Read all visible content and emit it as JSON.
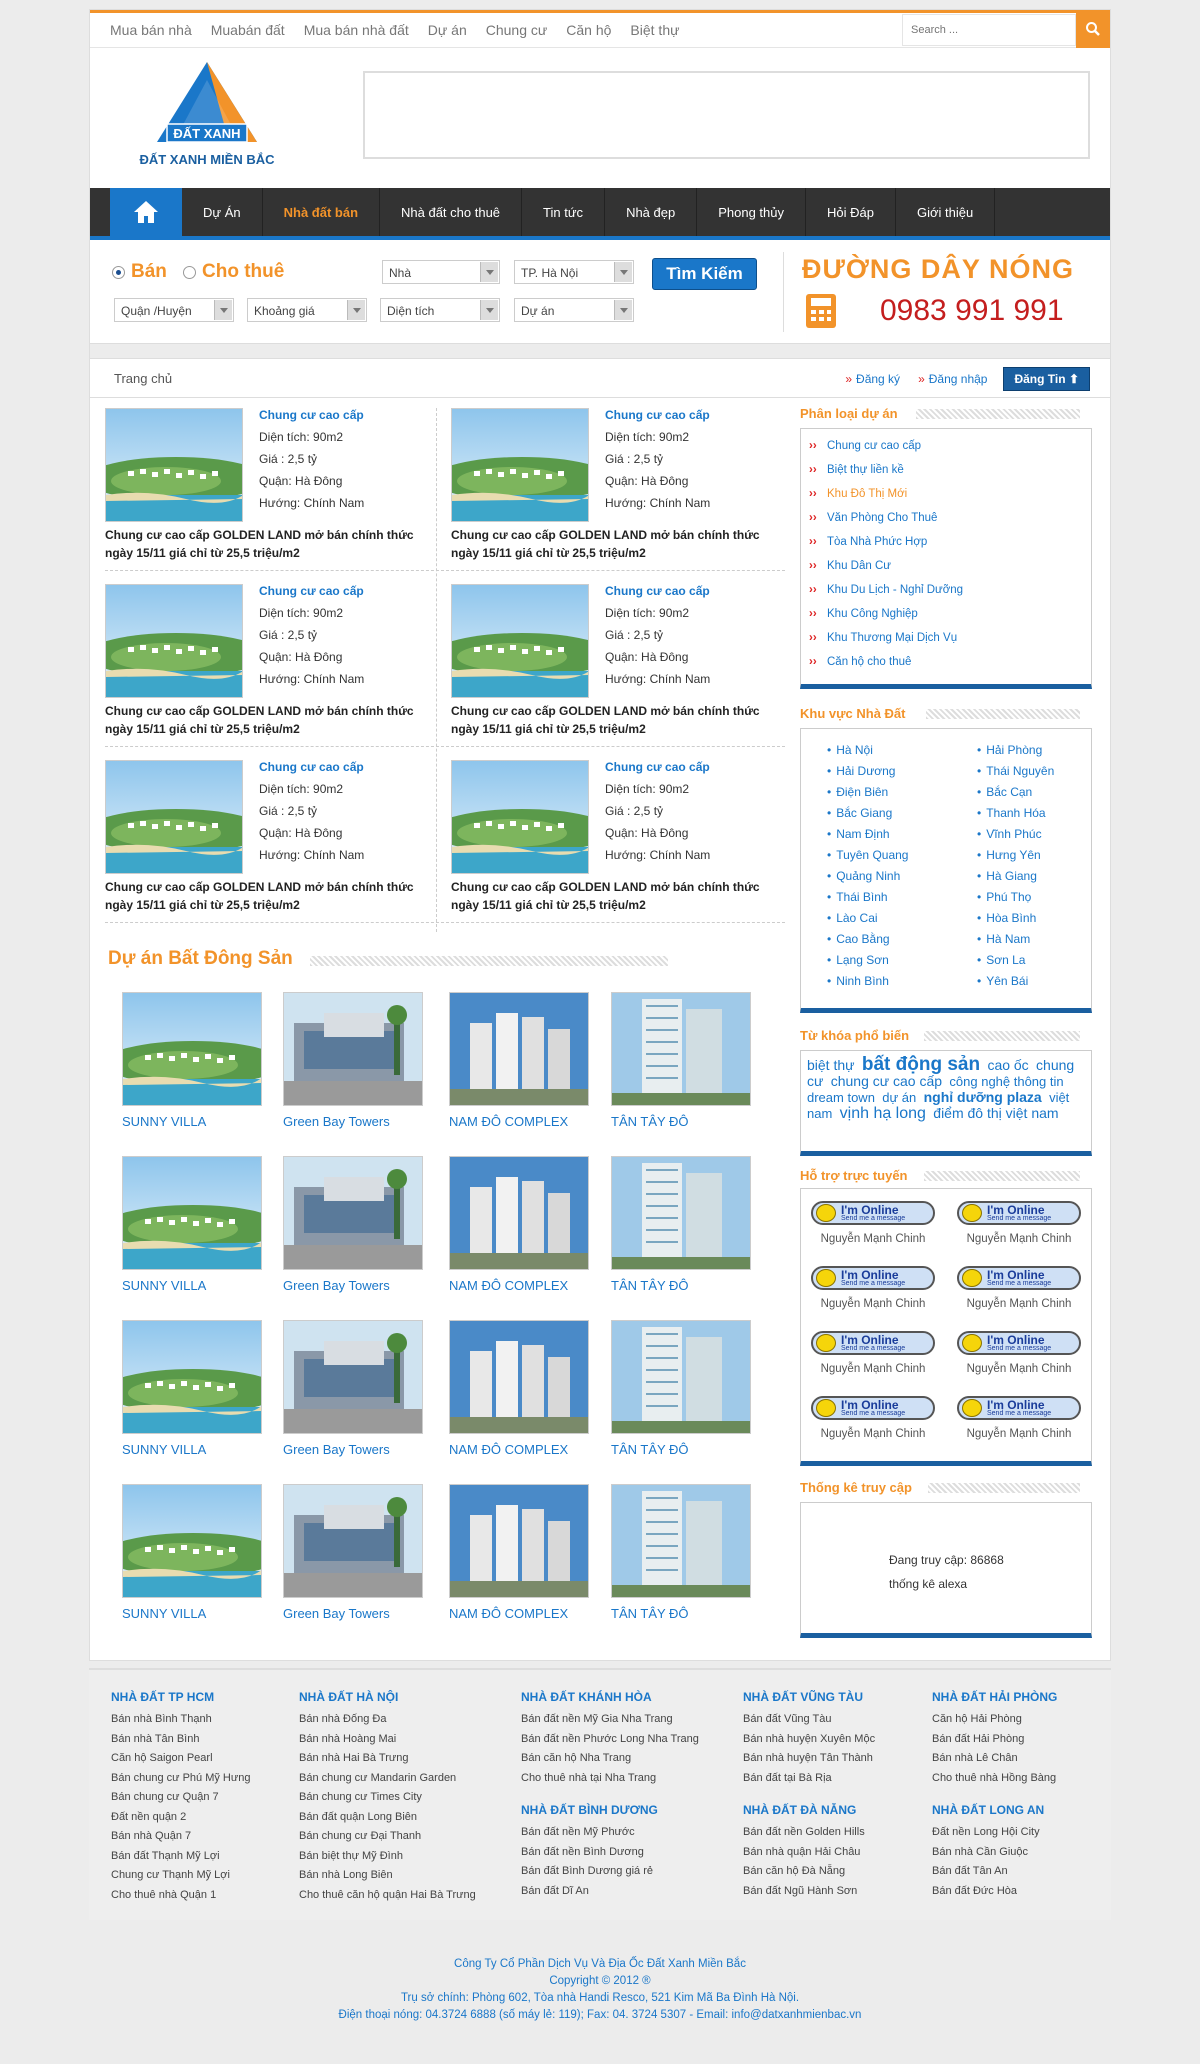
{
  "topnav": [
    "Mua bán nhà",
    "Muabán đất",
    "Mua bán nhà đất",
    "Dự án",
    "Chung cư",
    "Căn hộ",
    "Biệt thự"
  ],
  "search": {
    "placeholder": "Search ..."
  },
  "logo": {
    "brand": "ĐẤT XANH",
    "tagline": "ĐẤT XANH MIỀN BẮC"
  },
  "mainnav": [
    "Dự Án",
    "Nhà đất bán",
    "Nhà đất cho thuê",
    "Tin tức",
    "Nhà đẹp",
    "Phong thủy",
    "Hỏi Đáp",
    "Giới thiệu"
  ],
  "searchbox": {
    "sale": "Bán",
    "rent": "Cho thuê",
    "type": "Nhà",
    "city": "TP. Hà Nội",
    "district": "Quận /Huyện",
    "price": "Khoảng giá",
    "area": "Diện tích",
    "project": "Dự án",
    "button": "Tìm Kiếm"
  },
  "hotline": {
    "title": "ĐƯỜNG DÂY NÓNG",
    "number": "0983 991 991"
  },
  "breadcrumb": {
    "home": "Trang chủ",
    "register": "Đăng ký",
    "login": "Đăng nhập",
    "post": "Đăng Tin"
  },
  "listings": [
    {
      "cat": "Chung cư cao cấp",
      "area": "Diện tích: 90m2",
      "price": "Giá : 2,5 tỷ",
      "district": "Quận: Hà Đông",
      "dir": "Hướng: Chính Nam",
      "title": "Chung cư cao cấp GOLDEN LAND mở bán chính thức ngày 15/11 giá chỉ từ 25,5 triệu/m2"
    },
    {
      "cat": "Chung cư cao cấp",
      "area": "Diện tích: 90m2",
      "price": "Giá : 2,5 tỷ",
      "district": "Quận: Hà Đông",
      "dir": "Hướng: Chính Nam",
      "title": "Chung cư cao cấp GOLDEN LAND mở bán chính thức ngày 15/11 giá chỉ từ 25,5 triệu/m2"
    },
    {
      "cat": "Chung cư cao cấp",
      "area": "Diện tích: 90m2",
      "price": "Giá : 2,5 tỷ",
      "district": "Quận: Hà Đông",
      "dir": "Hướng: Chính Nam",
      "title": "Chung cư cao cấp GOLDEN LAND mở bán chính thức ngày 15/11 giá chỉ từ 25,5 triệu/m2"
    },
    {
      "cat": "Chung cư cao cấp",
      "area": "Diện tích: 90m2",
      "price": "Giá : 2,5 tỷ",
      "district": "Quận: Hà Đông",
      "dir": "Hướng: Chính Nam",
      "title": "Chung cư cao cấp GOLDEN LAND mở bán chính thức ngày 15/11 giá chỉ từ 25,5 triệu/m2"
    },
    {
      "cat": "Chung cư cao cấp",
      "area": "Diện tích: 90m2",
      "price": "Giá : 2,5 tỷ",
      "district": "Quận: Hà Đông",
      "dir": "Hướng: Chính Nam",
      "title": "Chung cư cao cấp GOLDEN LAND mở bán chính thức ngày 15/11 giá chỉ từ 25,5 triệu/m2"
    },
    {
      "cat": "Chung cư cao cấp",
      "area": "Diện tích: 90m2",
      "price": "Giá : 2,5 tỷ",
      "district": "Quận: Hà Đông",
      "dir": "Hướng: Chính Nam",
      "title": "Chung cư cao cấp GOLDEN LAND mở bán chính thức ngày 15/11 giá chỉ từ 25,5 triệu/m2"
    }
  ],
  "projects_title": "Dự án Bất Đông Sản",
  "projects": [
    "SUNNY VILLA",
    "Green Bay Towers",
    "NAM ĐÔ COMPLEX",
    "TÂN TÂY ĐÔ"
  ],
  "sidebar": {
    "categories_title": "Phân loại dự án",
    "categories": [
      "Chung cư cao cấp",
      "Biệt thự liền kề",
      "Khu Đô Thị Mới",
      "Văn Phòng Cho Thuê",
      "Tòa Nhà Phức Hợp",
      "Khu Dân Cư",
      "Khu Du Lịch - Nghỉ Dưỡng",
      "Khu Công Nghiệp",
      "Khu Thương Mại Dịch Vụ",
      "Căn hộ cho thuê"
    ],
    "regions_title": "Khu vực Nhà Đất",
    "regions": [
      "Hà Nội",
      "Hải Phòng",
      "Hải Dương",
      "Thái Nguyên",
      "Điện Biên",
      "Bắc Cạn",
      "Bắc Giang",
      "Thanh Hóa",
      "Nam Định",
      "Vĩnh Phúc",
      "Tuyên Quang",
      "Hưng Yên",
      "Quảng Ninh",
      "Hà Giang",
      "Thái Bình",
      "Phú Thọ",
      "Lào Cai",
      "Hòa Bình",
      "Cao Bằng",
      "Hà Nam",
      "Lạng Sơn",
      "Sơn La",
      "Ninh Bình",
      "Yên Bái"
    ],
    "tags_title": "Từ khóa phổ biến",
    "tags": [
      "biệt thự",
      "bất động sản",
      "cao ốc",
      "chung cư",
      "chung cư cao cấp",
      "công nghệ thông tin",
      "dream town",
      "dự án",
      "nghỉ dưỡng plaza",
      "việt nam",
      "vịnh hạ long",
      "điểm đô thị việt nam"
    ],
    "support_title": "Hỗ trợ trực tuyến",
    "support_online": "I'm Online",
    "support_msg": "Send me a message",
    "support_name": "Nguyễn Mạnh Chinh",
    "stats_title": "Thống kê truy cập",
    "stats_visits": "Đang truy cập: 86868",
    "stats_alexa": "thống kê alexa"
  },
  "footer": {
    "cols": [
      {
        "h": "NHÀ ĐẤT TP HCM",
        "items": [
          "Bán nhà Bình Thạnh",
          "Bán nhà Tân Bình",
          "Căn hộ Saigon Pearl",
          "Bán chung cư Phú Mỹ Hưng",
          "Bán chung cư Quận 7",
          "Đất nền quận 2",
          "Bán nhà Quận 7",
          "Bán đất Thạnh Mỹ Lợi",
          "Chung cư Thạnh Mỹ Lợi",
          "Cho thuê nhà Quận 1"
        ]
      },
      {
        "h": "NHÀ ĐẤT HÀ NỘI",
        "items": [
          "Bán nhà Đống Đa",
          "Bán nhà Hoàng Mai",
          "Bán nhà Hai Bà Trưng",
          "Bán chung cư Mandarin Garden",
          "Bán chung cư Times City",
          "Bán đất quận Long Biên",
          "Bán chung cư Đại Thanh",
          "Bán biệt thự Mỹ Đình",
          "Bán nhà Long Biên",
          "Cho thuê căn hộ quận Hai Bà Trưng"
        ]
      },
      {
        "h": "NHÀ ĐẤT KHÁNH HÒA",
        "items": [
          "Bán đất nền Mỹ Gia Nha Trang",
          "Bán đất nền Phước Long Nha Trang",
          "Bán căn hộ Nha Trang",
          "Cho thuê nhà tại Nha Trang"
        ]
      },
      {
        "h": "NHÀ ĐẤT VŨNG TÀU",
        "items": [
          "Bán đất Vũng Tàu",
          "Bán nhà huyện Xuyên Mộc",
          "Bán nhà huyện Tân Thành",
          "Bán đất tại Bà Rịa"
        ]
      },
      {
        "h": "NHÀ ĐẤT HẢI PHÒNG",
        "items": [
          "Căn hộ Hải Phòng",
          "Bán đất Hải Phòng",
          "Bán nhà Lê Chân",
          "Cho thuê nhà Hồng Bàng"
        ]
      },
      {
        "h": "NHÀ ĐẤT BÌNH DƯƠNG",
        "items": [
          "Bán đất nền Mỹ Phước",
          "Bán đất nền Bình Dương",
          "Bán đất Bình Dương giá rẻ",
          "Bán đất Dĩ An"
        ]
      },
      {
        "h": "NHÀ ĐẤT ĐÀ NẴNG",
        "items": [
          "Bán đất nền Golden Hills",
          "Bán nhà quận Hải Châu",
          "Bán căn hộ Đà Nẵng",
          "Bán đất Ngũ Hành Sơn"
        ]
      },
      {
        "h": "NHÀ ĐẤT LONG AN",
        "items": [
          "Đất nền Long Hội City",
          "Bán nhà Cần Giuộc",
          "Bán đất Tân An",
          "Bán đất Đức Hòa"
        ]
      }
    ],
    "copy": [
      "Công Ty Cổ Phần Dịch Vụ Và Địa Ốc Đất Xanh Miền Bắc",
      "Copyright © 2012 ®",
      "Trụ sở chính: Phòng 602, Tòa nhà Handi Resco, 521 Kim Mã Ba Đình Hà Nội.",
      "Điện thoại nóng: 04.3724 6888 (số máy lẻ: 119); Fax: 04. 3724 5307 - Email: info@datxanhmienbac.vn"
    ]
  }
}
